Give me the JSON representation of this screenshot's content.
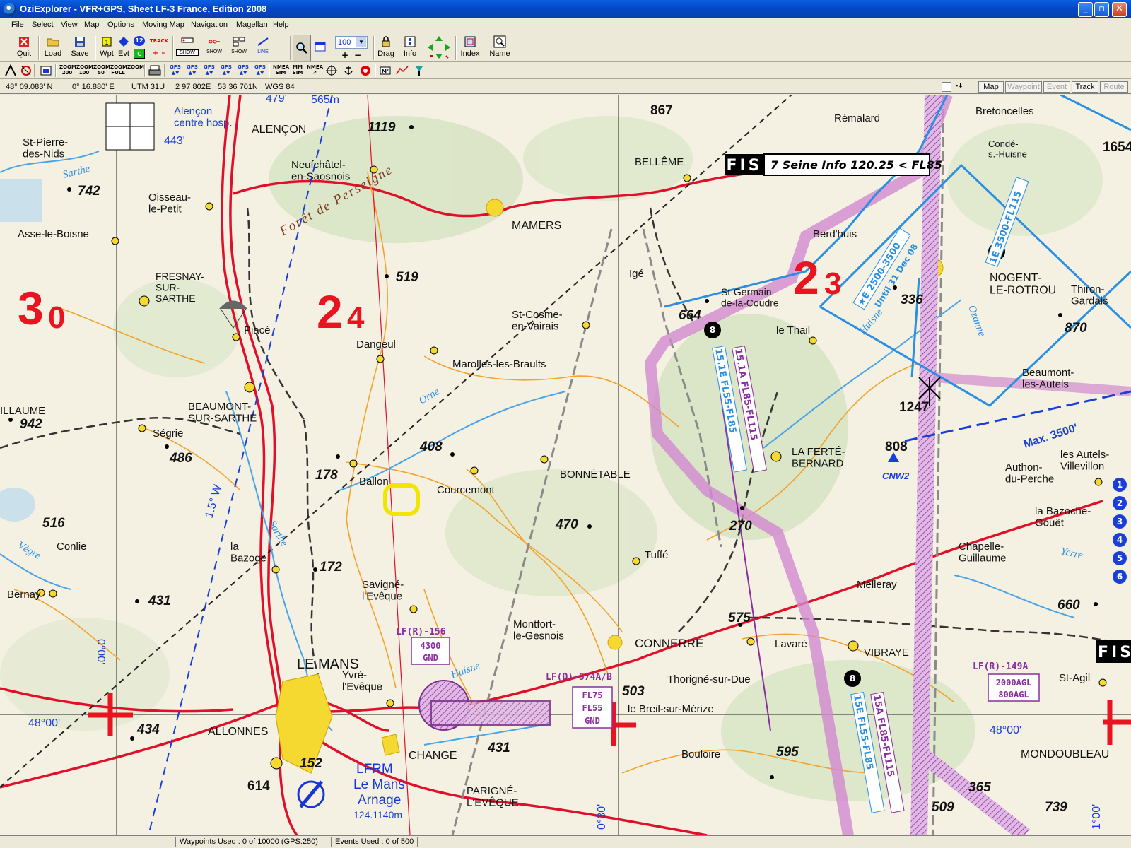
{
  "window": {
    "title": "OziExplorer - VFR+GPS, Sheet LF-3  France, Edition 2008"
  },
  "menu": [
    "File",
    "Select",
    "View",
    "Map",
    "Options",
    "Moving Map",
    "Navigation",
    "Magellan",
    "Help"
  ],
  "toolbar": {
    "quit": "Quit",
    "load": "Load",
    "save": "Save",
    "wpt": "Wpt",
    "evt": "Evt",
    "track": "TRACK",
    "show": "SHOW",
    "line": "LINE",
    "zoom_value": "100",
    "drag": "Drag",
    "info": "Info",
    "index": "Index",
    "name": "Name"
  },
  "toolbar2": {
    "zoom200": "ZOOM\n200",
    "zoom100": "ZOOM\n100",
    "zoom50": "ZOOM\n50",
    "zoom_full": "ZOOM\nFULL",
    "zoom": "ZOOM",
    "gps": "GPS",
    "nmea_sim": "NMEA\nSIM",
    "mm_sim": "MM\nSIM",
    "nmea": "NMEA"
  },
  "infobar": {
    "lat": "48° 09.083' N",
    "lon": "0° 16.880' E",
    "zone": "UTM 31U",
    "easting": "2 97 802E",
    "northing": "53 36 701N",
    "datum": "WGS 84",
    "tabs": [
      "Map",
      "Waypoint",
      "Event",
      "Track",
      "Route"
    ]
  },
  "statusbar": {
    "waypoints": "Waypoints Used : 0 of 10000  (GPS:250)",
    "events": "Events Used : 0 of 500"
  },
  "map": {
    "towns": [
      "ALENÇON",
      "Alençon\ncentre hosp.",
      "St-Pierre-\ndes-Nids",
      "Oisseau-\nle-Petit",
      "Asse-le-Boisne",
      "Neufchâtel-\nen-Saosnois",
      "MAMERS",
      "BELLÊME",
      "Rémalard",
      "Bretoncelles",
      "Condé-\ns.-Huisne",
      "Berd'huis",
      "NOGENT-\nLE-ROTROU",
      "Thiron-\nGardais",
      "FRESNAY-\nSUR-\nSARTHE",
      "Piacé",
      "Dangeul",
      "Marolles-les-Braults",
      "St-Cosme-\nen-Vairais",
      "Igé",
      "St-Germain-\nde-la-Coudre",
      "le Thail",
      "Beaumont-\nles-Autels",
      "BEAUMONT-\nSUR-SARTHE",
      "Ségrie",
      "Ballon",
      "Courcemont",
      "BONNÉTABLE",
      "LA FERTÉ-\nBERNARD",
      "Authon-\ndu-Perche",
      "les Autels-\nVillevillon",
      "la Bazoche-\nGouët",
      "Chapelle-\nGuillaume",
      "Conlie",
      "la\nBazoge",
      "Tuffé",
      "Melleray",
      "Bernay",
      "Savigné-\nl'Evêque",
      "Montfort-\nle-Gesnois",
      "CONNERRÉ",
      "Lavaré",
      "VIBRAYE",
      "LE MANS",
      "Yvré-\nl'Evêque",
      "Thorigné-sur-Due",
      "le Breil-sur-Mérize",
      "St-Agil",
      "ALLONNES",
      "CHANGE",
      "Bouloire",
      "MONDOUBLEAU",
      "PARIGNÉ-\nL'EVÊQUE",
      "ILLAUME"
    ],
    "elevations": [
      "1119",
      "742",
      "519",
      "867",
      "1654",
      "664",
      "336",
      "870",
      "1247",
      "942",
      "486",
      "408",
      "178",
      "808",
      "516",
      "470",
      "270",
      "172",
      "431",
      "575",
      "660",
      "434",
      "503",
      "152",
      "614",
      "431",
      "595",
      "365",
      "509",
      "739"
    ],
    "sectors": [
      "3",
      "0",
      "2",
      "4",
      "2",
      "3"
    ],
    "rivers": [
      "Sarthe",
      "Orne",
      "Huisne",
      "Vègre",
      "Yerre",
      "Ozanne",
      "Huisne",
      "Sarthe"
    ],
    "forest": "Forêt de Perseigne",
    "fis_label": "FIS",
    "fis_text": "7 Seine Info 120.25 < FL85",
    "fis_label2": "FIS",
    "airspace": [
      "LF(R)-156",
      "LF(D)-574A/B",
      "LF(R)-149A"
    ],
    "airspace_boxes": [
      "4300",
      "GND",
      "FL75",
      "FL55",
      "GND",
      "2000AGL",
      "800AGL"
    ],
    "corridors": [
      "15.1A FL85-FL115",
      "15.1E FL55-FL85",
      "15A FL85-FL115",
      "15E FL55-FL85",
      "★E 2500-3500",
      "Until 31 Dec 08",
      "1E 3500-FL115"
    ],
    "airfield": [
      "LFRM",
      "Le Mans",
      "Arnage"
    ],
    "misc": [
      "443'",
      "565m",
      "479'",
      "1.5° W",
      "48°00'",
      "48°00'",
      "0°00'",
      "0°30'",
      "1°00'",
      "Max. 3500'",
      "CNW2",
      "124.1140m"
    ],
    "route_markers": [
      "1",
      "2",
      "3",
      "4",
      "5",
      "6",
      "8",
      "8",
      "8"
    ]
  },
  "colors": {
    "title_bar": "#0a4fd1",
    "road_red": "#e0102a",
    "airspace_blue": "#2a8fe3",
    "corridor_magenta": "#c04bb8",
    "sector_red": "#e8141f",
    "town_yellow": "#f5d930"
  }
}
